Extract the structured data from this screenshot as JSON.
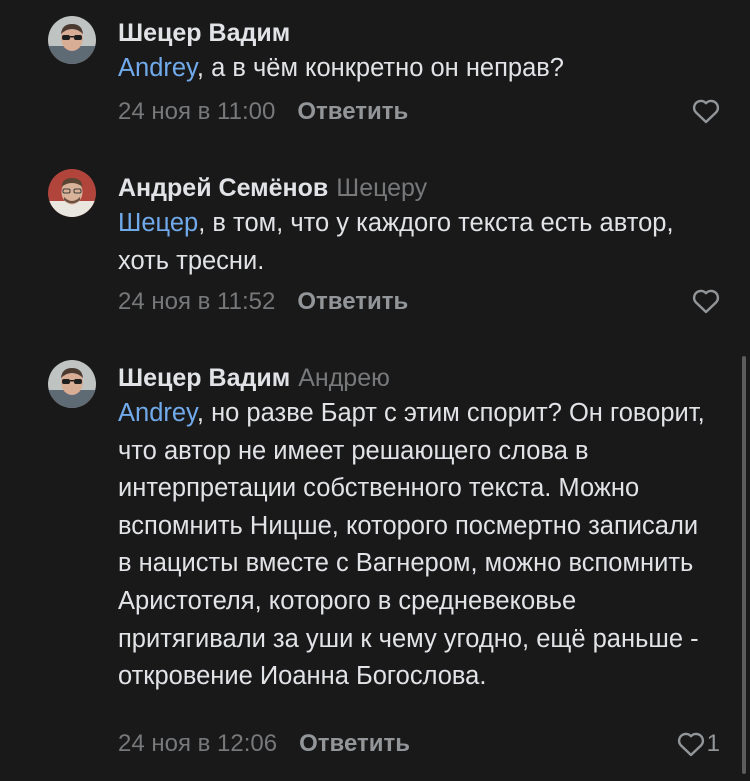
{
  "comments": [
    {
      "author": "Шецер Вадим",
      "reply_to": "",
      "mention": "Andrey",
      "text": ", а в чём конкретно он неправ?",
      "date": "24 ноя в 11:00",
      "reply_label": "Ответить",
      "likes": ""
    },
    {
      "author": "Андрей Семёнов",
      "reply_to": "Шецеру",
      "mention": "Шецер",
      "text": ", в том, что у каждого текста есть автор, хоть тресни.",
      "date": "24 ноя в 11:52",
      "reply_label": "Ответить",
      "likes": ""
    },
    {
      "author": "Шецер Вадим",
      "reply_to": "Андрею",
      "mention": "Andrey",
      "text": ", но разве Барт с этим спорит? Он говорит, что автор не имеет решающего слова в интерпретации собственного текста. Можно вспомнить Ницше, которого посмертно записали в нацисты вместе с Вагнером, можно вспомнить Аристотеля, которого в средневековье притягивали за уши к чему угодно, ещё раньше - откровение Иоанна Богослова.",
      "date": "24 ноя в 12:06",
      "reply_label": "Ответить",
      "likes": "1"
    }
  ],
  "colors": {
    "background": "#19191a",
    "text": "#e1e3e6",
    "secondary": "#76787a",
    "link": "#71aaeb",
    "accent_button": "#939699"
  },
  "icons": {
    "avatar": "user-photo-avatar",
    "like": "heart-outline-icon"
  }
}
